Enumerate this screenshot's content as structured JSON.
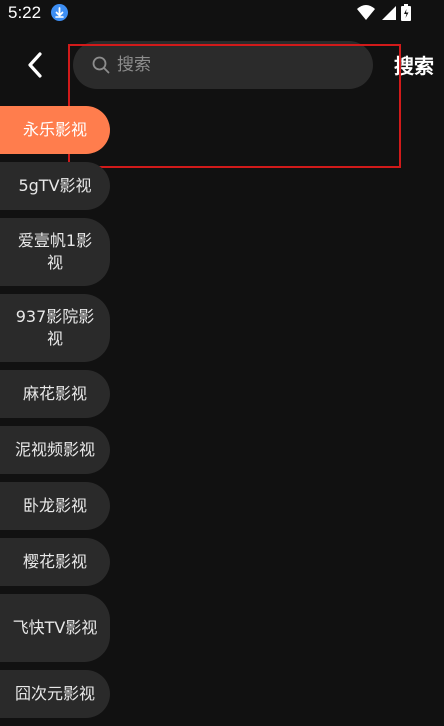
{
  "status_bar": {
    "time": "5:22",
    "download_icon": "download-icon",
    "wifi_icon": "wifi-icon",
    "signal_icon": "signal-icon",
    "battery_icon": "battery-icon"
  },
  "header": {
    "back_icon": "chevron-left-icon",
    "search_placeholder": "搜索",
    "search_value": "",
    "search_button_label": "搜索"
  },
  "sources": [
    {
      "label": "永乐影视",
      "active": true
    },
    {
      "label": "5gTV影视",
      "active": false
    },
    {
      "label": "爱壹帆1影视",
      "active": false
    },
    {
      "label": "937影院影视",
      "active": false
    },
    {
      "label": "麻花影视",
      "active": false
    },
    {
      "label": "泥视频影视",
      "active": false
    },
    {
      "label": "卧龙影视",
      "active": false
    },
    {
      "label": "樱花影视",
      "active": false
    },
    {
      "label": "飞快TV影视",
      "active": false
    },
    {
      "label": "囧次元影视",
      "active": false
    }
  ],
  "colors": {
    "background": "#111111",
    "active_item": "#ff7d4d",
    "inactive_item": "#2a2a2a",
    "search_box": "#2b2b2b",
    "highlight_border": "#d11a1a"
  }
}
